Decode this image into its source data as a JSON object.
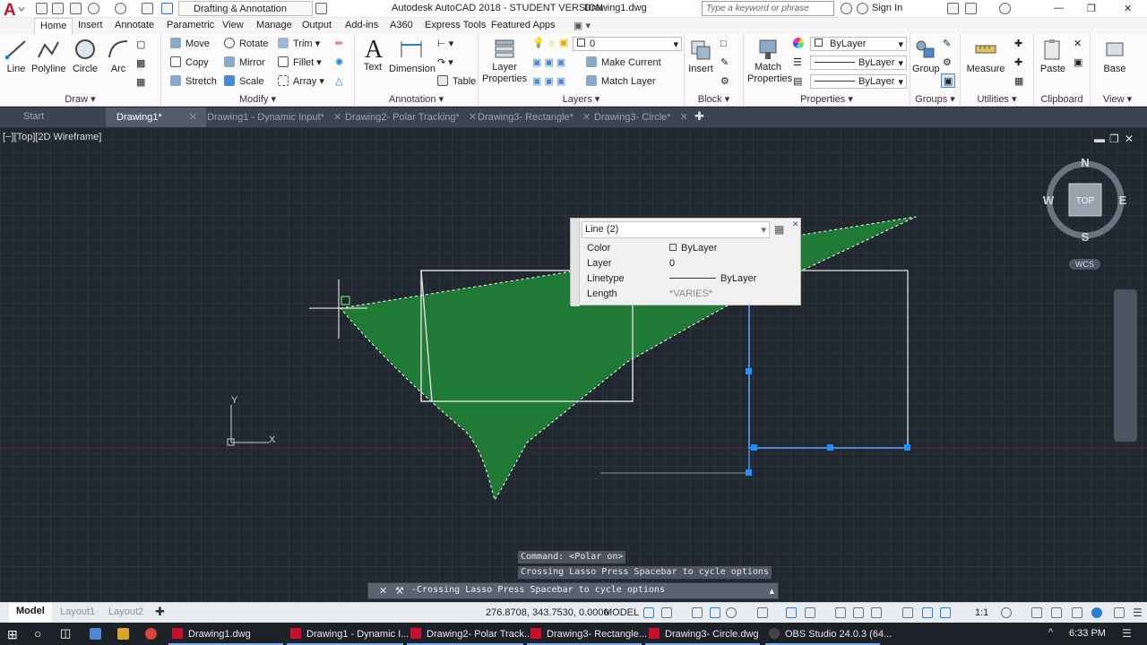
{
  "title_bar": {
    "workspace": "Drafting & Annotation",
    "title": "Autodesk AutoCAD 2018 - STUDENT VERSION",
    "filename": "Drawing1.dwg",
    "search_placeholder": "Type a keyword or phrase",
    "sign_in": "Sign In"
  },
  "ribbon_tabs": [
    "Home",
    "Insert",
    "Annotate",
    "Parametric",
    "View",
    "Manage",
    "Output",
    "Add-ins",
    "A360",
    "Express Tools",
    "Featured Apps"
  ],
  "panels": {
    "draw": {
      "title": "Draw",
      "tools": [
        "Line",
        "Polyline",
        "Circle",
        "Arc"
      ]
    },
    "modify": {
      "title": "Modify",
      "tools": [
        "Move",
        "Rotate",
        "Trim",
        "Copy",
        "Mirror",
        "Fillet",
        "Stretch",
        "Scale",
        "Array"
      ]
    },
    "annotation": {
      "title": "Annotation",
      "tools": [
        "Text",
        "Dimension",
        "Table"
      ]
    },
    "layers": {
      "title": "Layers",
      "layer_properties": "Layer Properties",
      "current_layer": "0",
      "make_current": "Make Current",
      "match_layer": "Match Layer"
    },
    "block": {
      "title": "Block",
      "insert": "Insert"
    },
    "properties": {
      "title": "Properties",
      "match": "Match Properties",
      "color": "ByLayer",
      "linetype": "ByLayer",
      "lineweight": "ByLayer"
    },
    "groups": {
      "title": "Groups",
      "group": "Group"
    },
    "utilities": {
      "title": "Utilities",
      "measure": "Measure"
    },
    "clipboard": {
      "title": "Clipboard",
      "paste": "Paste"
    },
    "view": {
      "title": "View",
      "base": "Base"
    }
  },
  "doc_tabs": [
    "Start",
    "Drawing1*",
    "Drawing1 - Dynamic Input*",
    "Drawing2- Polar Tracking*",
    "Drawing3- Rectangle*",
    "Drawing3- Circle*"
  ],
  "active_doc_tab": "Drawing1*",
  "viewport_label": "[−][Top][2D Wireframe]",
  "viewcube": {
    "n": "N",
    "s": "S",
    "e": "E",
    "w": "W",
    "face": "TOP",
    "wcs": "WCS"
  },
  "ucs": {
    "x": "X",
    "y": "Y"
  },
  "quick_properties": {
    "header": "Line (2)",
    "rows": [
      {
        "k": "Color",
        "v": "ByLayer"
      },
      {
        "k": "Layer",
        "v": "0"
      },
      {
        "k": "Linetype",
        "v": "ByLayer"
      },
      {
        "k": "Length",
        "v": "*VARIES*"
      }
    ]
  },
  "command_history": [
    "Command:  <Polar on>",
    "Crossing Lasso  Press Spacebar to cycle options"
  ],
  "command_input": "-Crossing Lasso  Press Spacebar to cycle options",
  "status": {
    "layout_tabs": [
      "Model",
      "Layout1",
      "Layout2"
    ],
    "coords": "276.8708, 343.7530, 0.0000",
    "mode": "MODEL",
    "scale": "1:1"
  },
  "taskbar": {
    "items": [
      "Drawing1.dwg",
      "Drawing1 - Dynamic I...",
      "Drawing2- Polar Track...",
      "Drawing3- Rectangle...",
      "Drawing3- Circle.dwg",
      "OBS Studio 24.0.3 (64..."
    ],
    "time": "6:33 PM"
  },
  "colors": {
    "accent": "#c8102e",
    "lasso_fill": "#1f7a35",
    "selection": "#1e90ff",
    "viewport_bg": "#212830"
  }
}
